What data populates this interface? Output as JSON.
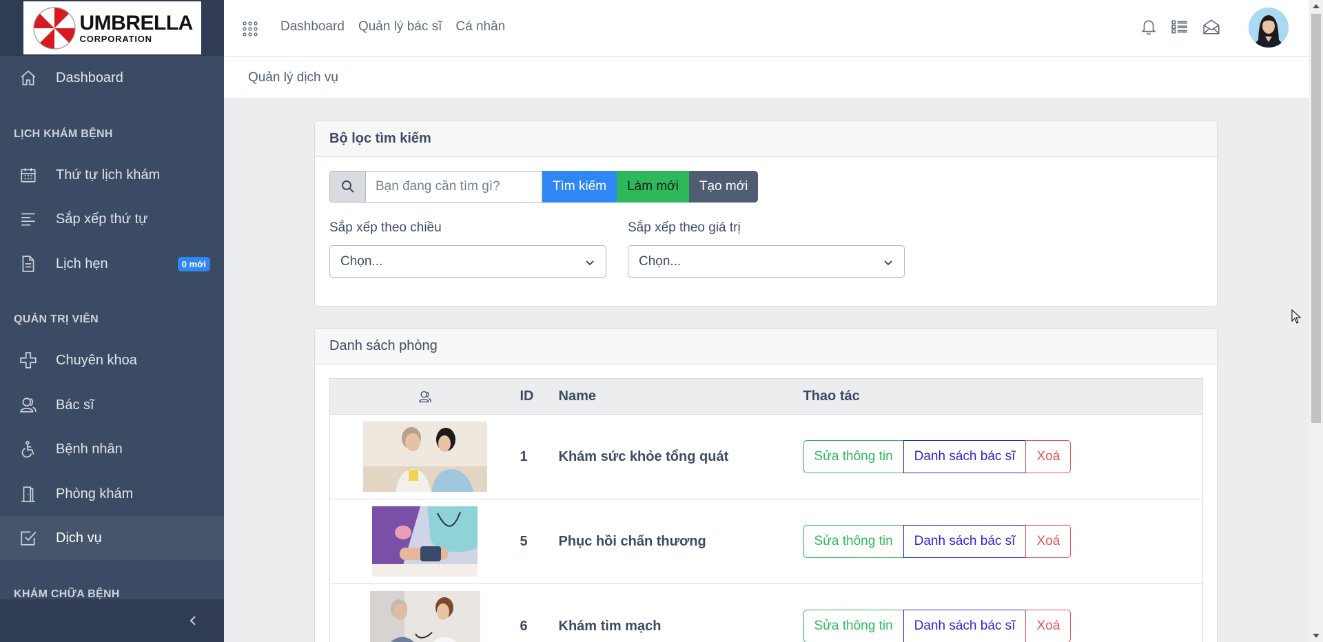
{
  "brand": {
    "logo_line1": "UMBRELLA",
    "logo_line2": "CORPORATION"
  },
  "sidebar": {
    "dashboard": "Dashboard",
    "section_schedule": "LỊCH KHÁM BỆNH",
    "schedule_order": "Thứ tự lịch khám",
    "sort_order": "Sắp xếp thứ tự",
    "appointments": "Lịch hẹn",
    "appointments_badge": "0 mới",
    "section_admin": "QUẢN TRỊ VIÊN",
    "specialty": "Chuyên khoa",
    "doctors": "Bác sĩ",
    "patients": "Bệnh nhân",
    "clinic": "Phòng khám",
    "services": "Dịch vụ",
    "section_treatment": "KHÁM CHỮA BỆNH"
  },
  "header": {
    "nav": [
      "Dashboard",
      "Quản lý bác sĩ",
      "Cá nhân"
    ],
    "breadcrumb": "Quản lý dịch vụ"
  },
  "filter": {
    "title": "Bộ lọc tìm kiếm",
    "search_placeholder": "Bạn đang cần tìm gì?",
    "btn_search": "Tìm kiếm",
    "btn_refresh": "Làm mới",
    "btn_create": "Tạo mới",
    "sort_direction_label": "Sắp xếp theo chiều",
    "sort_direction_value": "Chọn...",
    "sort_value_label": "Sắp xếp theo giá trị",
    "sort_value_value": "Chọn..."
  },
  "list": {
    "title": "Danh sách phòng",
    "columns": {
      "id": "ID",
      "name": "Name",
      "actions": "Thao tác"
    },
    "rows": [
      {
        "id": "1",
        "name": "Khám sức khỏe tổng quát"
      },
      {
        "id": "5",
        "name": "Phục hồi chấn thương"
      },
      {
        "id": "6",
        "name": "Khám tim mạch"
      }
    ],
    "btn_edit": "Sửa thông tin",
    "btn_doctors": "Danh sách bác sĩ",
    "btn_delete": "Xoá"
  },
  "colors": {
    "sidebar": "#3c4b64",
    "primary": "#2f86f5",
    "success": "#2eb85c",
    "dark": "#4f5d73",
    "indigo": "#321fdb",
    "danger": "#e55353"
  },
  "icons": [
    "home-icon",
    "calendar-icon",
    "list-icon",
    "document-icon",
    "plus-icon",
    "users-icon",
    "wheelchair-icon",
    "door-icon",
    "check-square-icon",
    "bell-icon",
    "task-list-icon",
    "envelope-icon",
    "search-icon",
    "chevron-left-icon",
    "chevron-down-icon",
    "apps-grid-icon"
  ]
}
